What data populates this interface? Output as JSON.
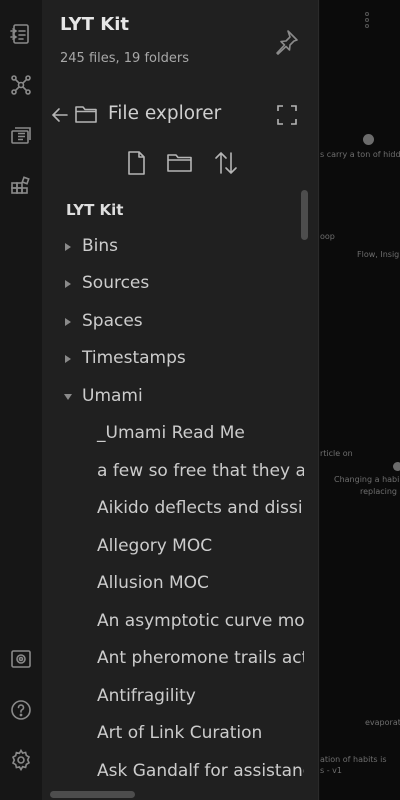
{
  "vault": {
    "name": "LYT Kit",
    "stats": "245 files, 19 folders"
  },
  "file_explorer": {
    "title": "File explorer",
    "root": "LYT Kit",
    "folders": [
      {
        "label": "Bins",
        "expanded": false
      },
      {
        "label": "Sources",
        "expanded": false
      },
      {
        "label": "Spaces",
        "expanded": false
      },
      {
        "label": "Timestamps",
        "expanded": false
      },
      {
        "label": "Umami",
        "expanded": true
      }
    ],
    "files": [
      "_Umami Read Me",
      "a few so free that they a",
      "Aikido deflects and dissip",
      "Allegory MOC",
      "Allusion MOC",
      "An asymptotic curve mod",
      "Ant pheromone trails act",
      "Antifragility",
      "Art of Link Curation",
      "Ask Gandalf for assistanc"
    ]
  },
  "ribbon": {
    "icons": [
      "quick-switcher-icon",
      "graph-view-icon",
      "slides-icon",
      "plugins-icon",
      "vault-icon",
      "help-icon",
      "settings-icon"
    ]
  },
  "graph_fragments": [
    "s carry a ton of hidd",
    "oop",
    "Flow, Insig",
    "rticle on",
    "Changing a habi",
    "replacing",
    "evaporat",
    "ation of habits is",
    "s - v1"
  ],
  "colors": {
    "panel_bg": "#202020",
    "ribbon_bg": "#161616",
    "canvas_bg": "#0b0b0b",
    "text": "#cccccc",
    "muted": "#a8a8a8"
  }
}
